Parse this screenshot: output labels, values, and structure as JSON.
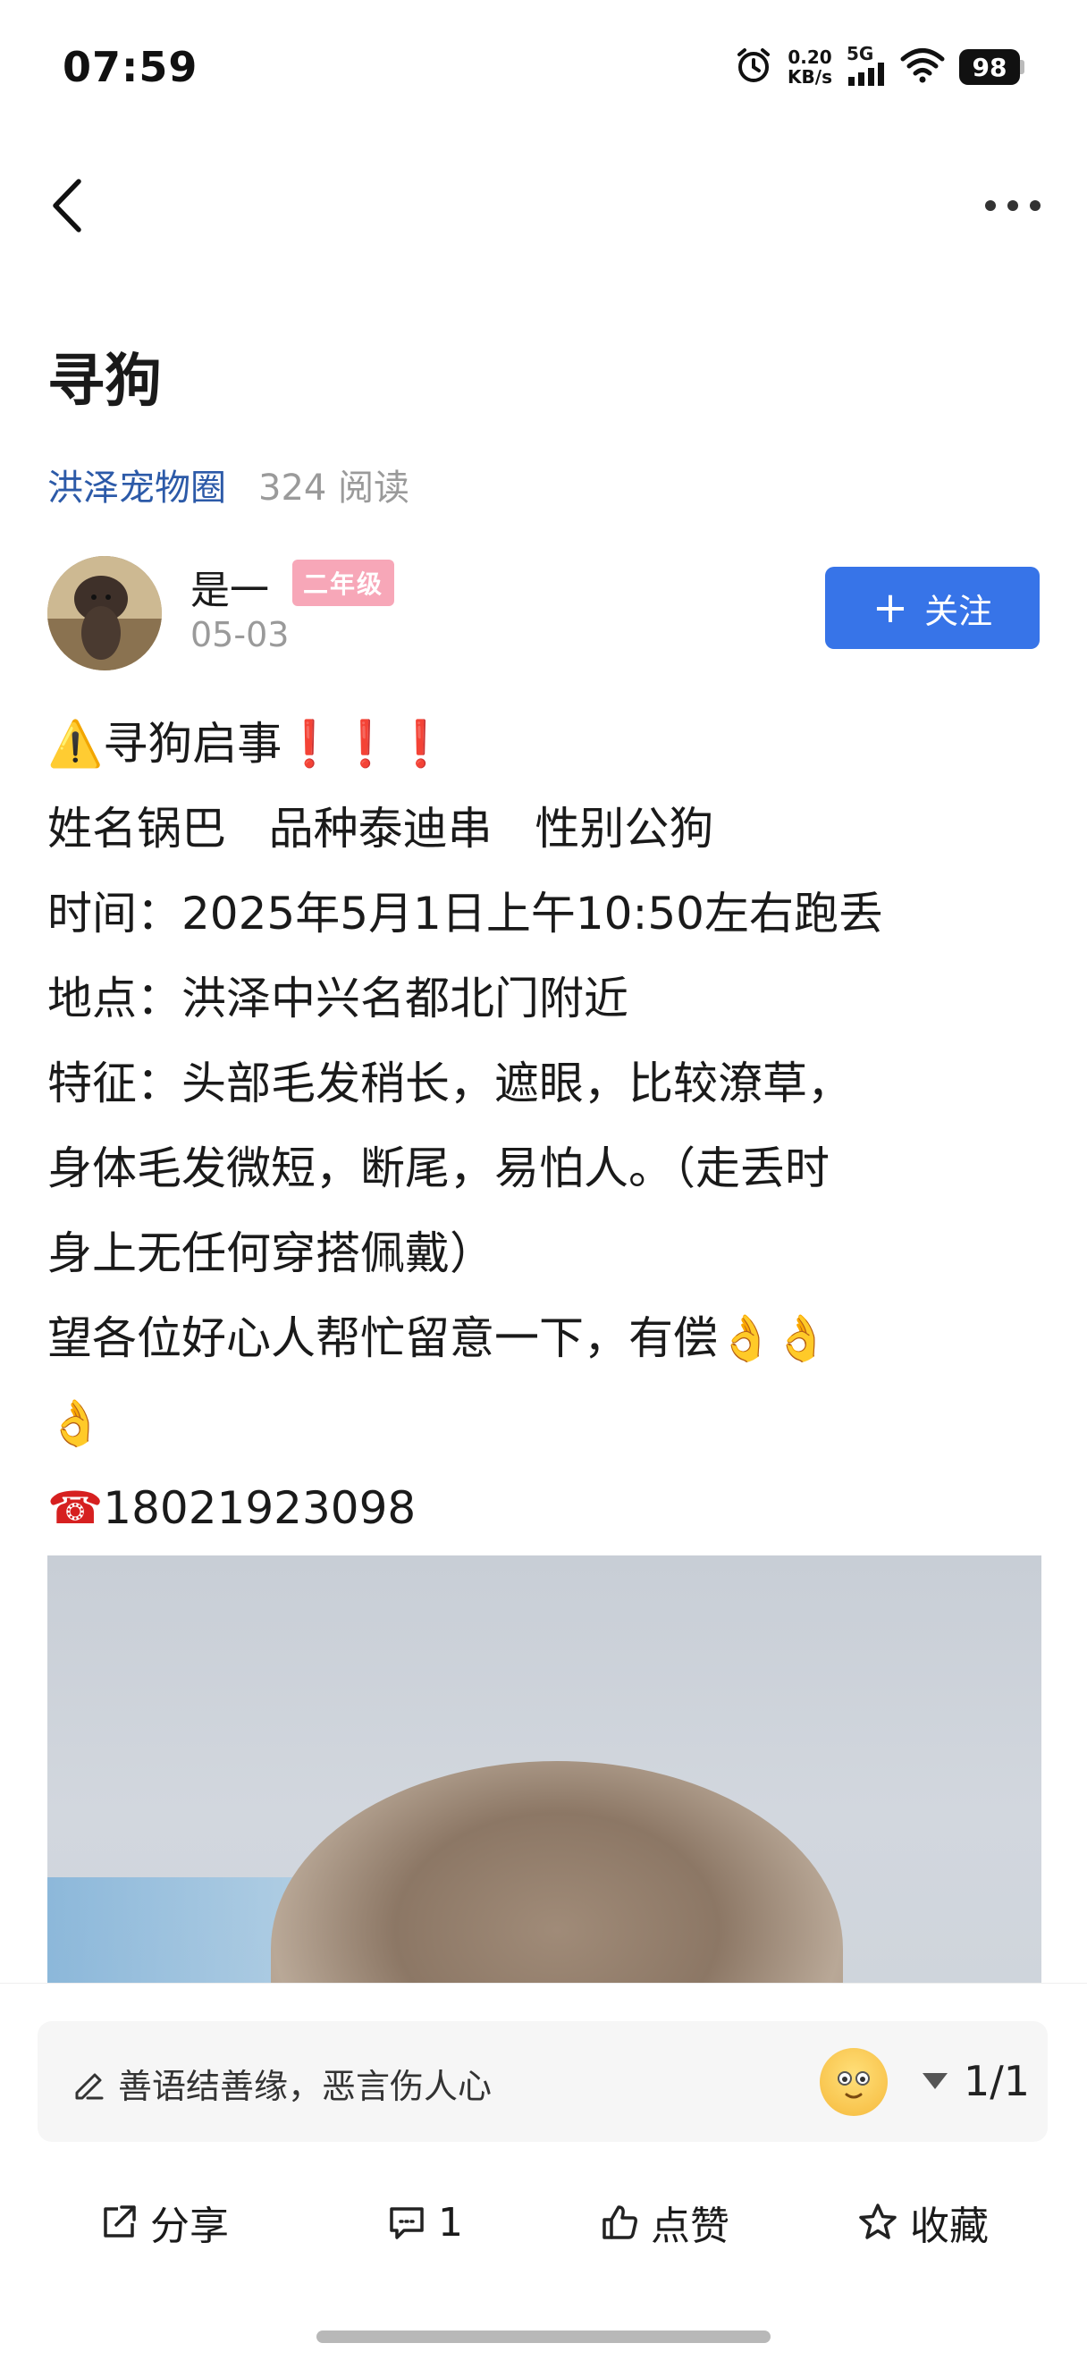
{
  "status_bar": {
    "time": "07:59",
    "net_speed_value": "0.20",
    "net_speed_unit": "KB/s",
    "network": "5G",
    "battery": "98",
    "icons": [
      "alarm-icon",
      "signal-icon",
      "wifi-icon",
      "battery-icon"
    ]
  },
  "nav": {
    "back_icon": "chevron-left-icon",
    "more_icon": "more-icon"
  },
  "post": {
    "title": "寻狗",
    "circle": "洪泽宠物圈",
    "read_count": "324 阅读",
    "author": {
      "name": "是一",
      "level": "二年级",
      "date": "05-03"
    },
    "follow_label": "关注",
    "content": {
      "line1_text": "寻狗启事",
      "line2": "姓名锅巴   品种泰迪串   性别公狗",
      "line3": "时间：2025年5月1日上午10:50左右跑丢",
      "line4": "地点：洪泽中兴名都北门附近",
      "line5": "特征：头部毛发稍长，遮眼，比较潦草，",
      "line6": "身体毛发微短，断尾，易怕人。（走丢时",
      "line7": "身上无任何穿搭佩戴）",
      "line8": "望各位好心人帮忙留意一下，有偿",
      "phone": "18021923098"
    }
  },
  "comment_bar": {
    "placeholder": "善语结善缘，恶言伤人心",
    "page_indicator": "1/1"
  },
  "actions": {
    "share": "分享",
    "comment_count": "1",
    "like": "点赞",
    "favorite": "收藏"
  },
  "colors": {
    "accent": "#3774e8",
    "circle_link": "#2c5aa8",
    "level_badge": "#f7a7b8",
    "muted": "#9a9a9a"
  }
}
